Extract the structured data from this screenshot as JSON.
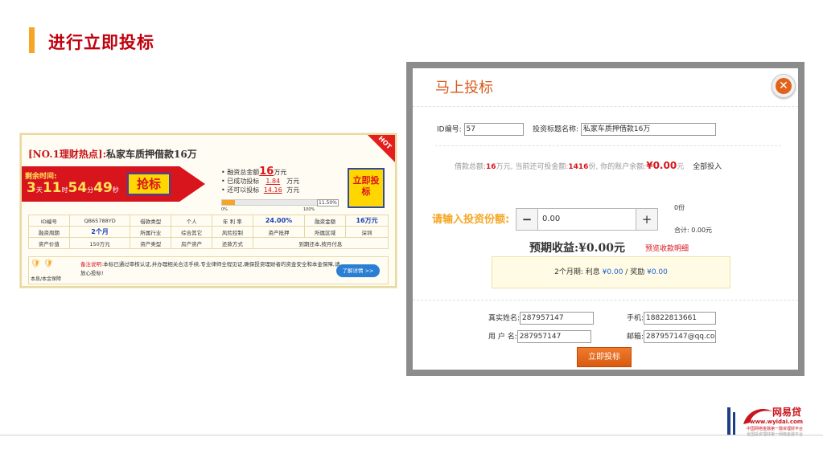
{
  "slide": {
    "title": "进行立即投标"
  },
  "loan_card": {
    "title_prefix": "[NO.1理财热点]:",
    "title_main": "私家车质押借款16万",
    "hot_badge": "HOT",
    "remain_label": "剩余时间:",
    "countdown": {
      "days": "3",
      "days_unit": "天",
      "hours": "11",
      "hours_unit": "时",
      "minutes": "54",
      "minutes_unit": "分",
      "seconds": "49",
      "seconds_unit": "秒"
    },
    "grab_button": "抢标",
    "fund_total_label": "融资总金额",
    "fund_total_value": "16",
    "fund_total_unit": "万元",
    "fund_done_label": "已成功投标",
    "fund_done_value": "1.84",
    "fund_done_unit": "万元",
    "fund_left_label": "还可以投标",
    "fund_left_value": "14.16",
    "fund_left_unit": "万元",
    "progress_percent": 11.5,
    "progress_label": "11.50%",
    "progress_start": "0%",
    "progress_end": "100%",
    "invest_button": "立即投标",
    "table": [
      [
        "ID编号",
        "QB65788YD",
        "借款类型",
        "个人",
        "年 利 率",
        "24.00%",
        "融资金额",
        "16万元"
      ],
      [
        "融资周期",
        "2个月",
        "所属行业",
        "综合其它",
        "风险控制",
        "资产抵押",
        "所属区域",
        "深圳"
      ],
      [
        "资产价值",
        "150万元",
        "资产类型",
        "房产资产",
        "还款方式",
        "到期还本,按月付息"
      ]
    ],
    "protect_label": "本息/本金保障",
    "remark_label": "备注说明:",
    "remark_text": "本标已通过审核认证,并办理相关合法手续,专业律师全程见证,确保投资理财者的资金安全和本金保障,请放心投标!",
    "more_button": "了解详情 >>"
  },
  "modal": {
    "title": "马上投标",
    "id_label": "ID编号:",
    "id_value": "57",
    "name_label": "投资标题名称:",
    "name_value": "私家车质押借款16万",
    "loan_total_label": "借款总额:",
    "loan_total_value": "16",
    "loan_total_unit": "万元,",
    "can_invest_label": "当前还可投金额:",
    "can_invest_value": "1416",
    "can_invest_unit": "份,",
    "balance_label": "你的账户余额:",
    "balance_value": "¥0.00",
    "balance_unit": "元",
    "all_invest": "全部投入",
    "amount_label": "请输入投资份额:",
    "minus": "−",
    "plus": "+",
    "amount_value": "0.00",
    "shares": "0份",
    "total": "合计: 0.00元",
    "expected_label": "预期收益:",
    "expected_value": "¥0.00元",
    "preview_link": "预览收款明细",
    "interest_period": "2个月期:",
    "interest_label": "利息",
    "interest_value": "¥0.00",
    "reward_label": "奖励",
    "reward_value": "¥0.00",
    "realname_label": "真实姓名:",
    "realname_value": "287957147",
    "phone_label": "手机:",
    "phone_value": "18822813661",
    "username_label": "用 户 名:",
    "username_value": "287957147",
    "email_label": "邮箱:",
    "email_value": "287957147@qq.com",
    "submit_button": "立即投标",
    "close_icon": "close-icon"
  },
  "logo": {
    "brand": "网易贷",
    "url": "www.wyidai.com",
    "tagline": "中国网络金融第一融资理财平台",
    "tagline2": "全国投资理财第一网络金融平台"
  },
  "colors": {
    "accent": "#c0000c",
    "orange": "#f5a623",
    "link_blue": "#1a5fd0"
  }
}
